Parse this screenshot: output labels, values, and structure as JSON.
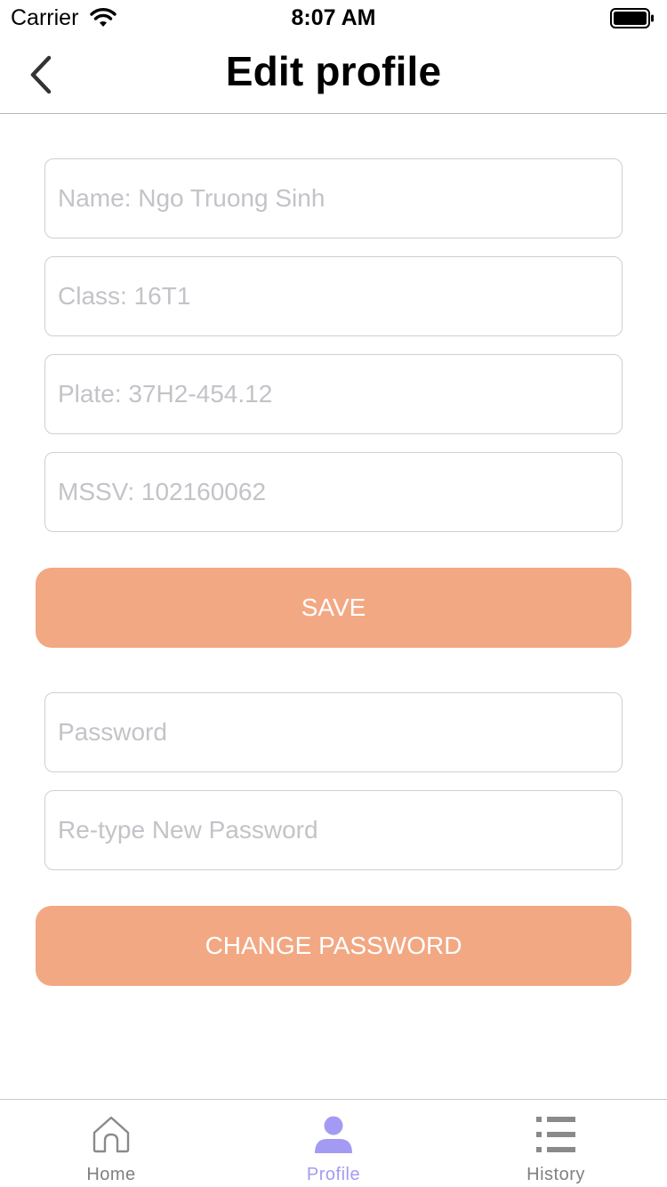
{
  "status_bar": {
    "carrier": "Carrier",
    "time": "8:07 AM"
  },
  "header": {
    "title": "Edit profile",
    "back_icon": "chevron-left-icon"
  },
  "profile_form": {
    "name_placeholder": "Name: Ngo Truong Sinh",
    "class_placeholder": "Class: 16T1",
    "plate_placeholder": "Plate: 37H2-454.12",
    "mssv_placeholder": "MSSV: 102160062",
    "save_label": "SAVE"
  },
  "password_form": {
    "password_placeholder": "Password",
    "retype_placeholder": "Re-type New Password",
    "change_label": "CHANGE PASSWORD"
  },
  "tab_bar": {
    "tabs": [
      {
        "label": "Home",
        "icon": "home-icon",
        "active": false
      },
      {
        "label": "Profile",
        "icon": "person-icon",
        "active": true
      },
      {
        "label": "History",
        "icon": "list-icon",
        "active": false
      }
    ],
    "active_color": "#a39bf3",
    "inactive_color": "#808080"
  },
  "colors": {
    "button_bg": "#f2a883",
    "button_text": "#ffffff",
    "placeholder": "#c3c3c8"
  }
}
